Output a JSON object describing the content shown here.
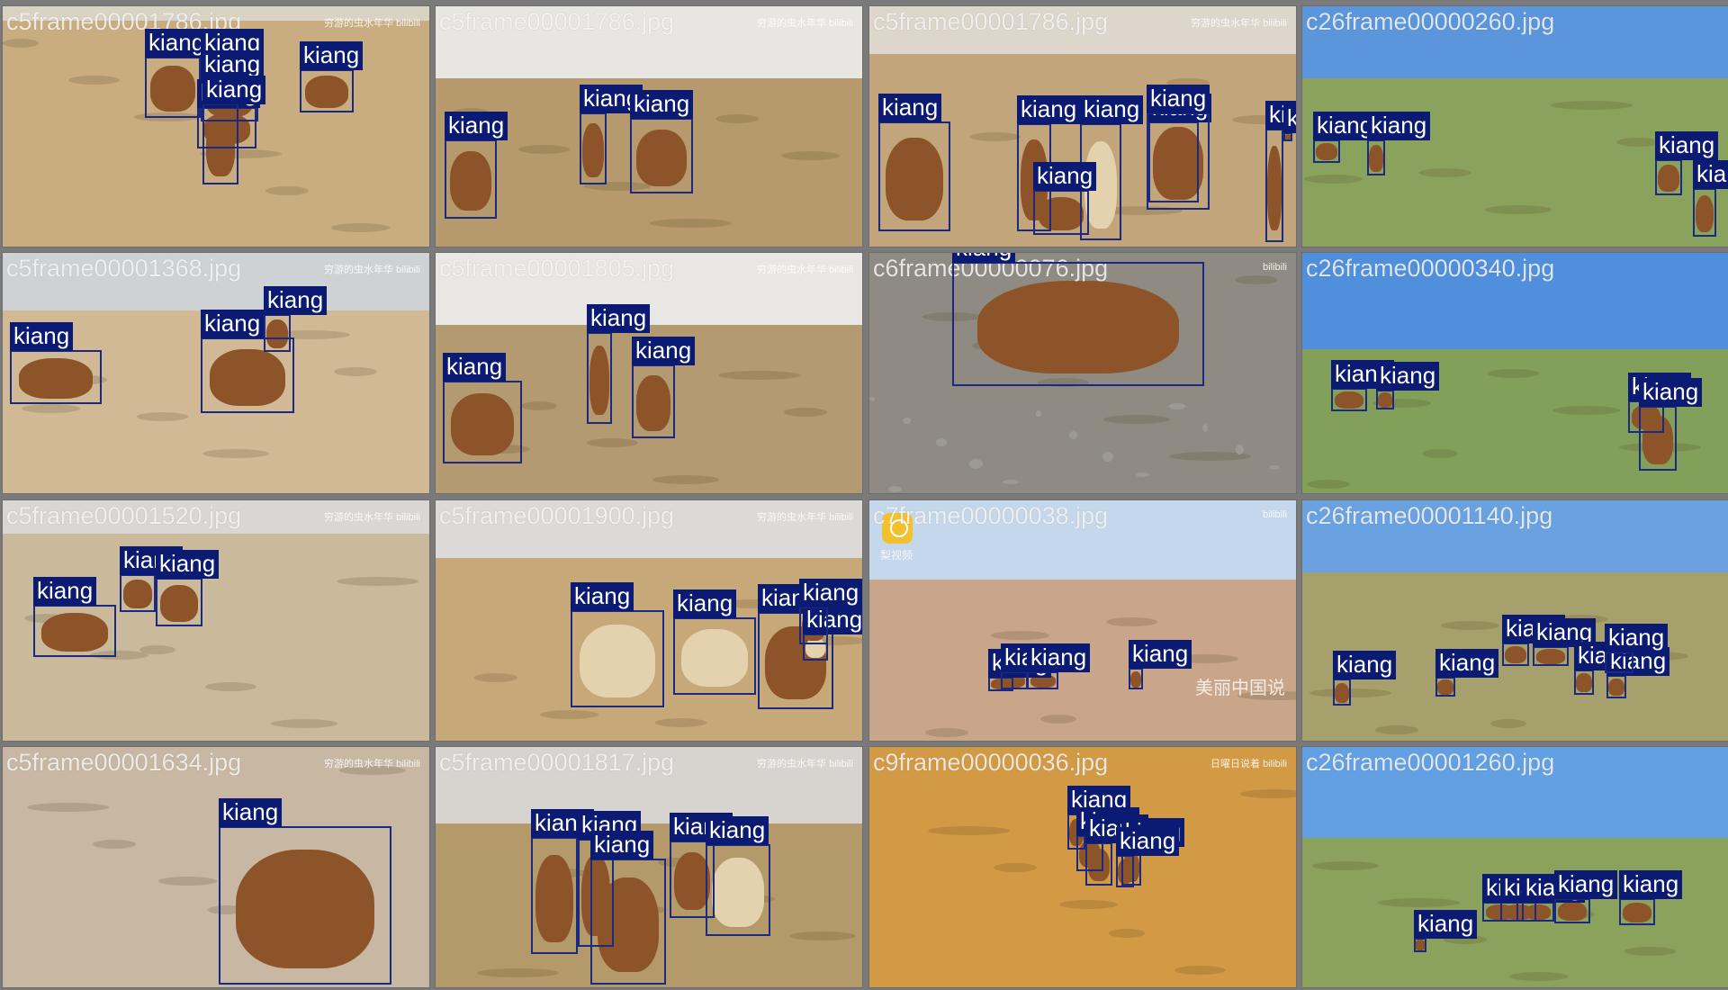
{
  "mosaic": {
    "tiles": [
      {
        "filename": "c5frame00001786.jpg",
        "watermark": "穷游的虫水年华 bilibili"
      },
      {
        "filename": "c5frame00001786.jpg",
        "watermark": "穷游的虫水年华 bilibili"
      },
      {
        "filename": "c5frame00001786.jpg",
        "watermark": "穷游的虫水年华 bilibili"
      },
      {
        "filename": "c26frame00000260.jpg",
        "watermark": ""
      },
      {
        "filename": "c5frame00001368.jpg",
        "watermark": "穷游的虫水年华 bilibili"
      },
      {
        "filename": "c5frame00001805.jpg",
        "watermark": "穷游的虫水年华 bilibili"
      },
      {
        "filename": "c6frame00000076.jpg",
        "watermark": "bilibili"
      },
      {
        "filename": "c26frame00000340.jpg",
        "watermark": ""
      },
      {
        "filename": "c5frame00001520.jpg",
        "watermark": "穷游的虫水年华 bilibili"
      },
      {
        "filename": "c5frame00001900.jpg",
        "watermark": "穷游的虫水年华 bilibili"
      },
      {
        "filename": "c7frame00000038.jpg",
        "watermark": "bilibili",
        "overlay": "美丽中国说",
        "logo_text": "梨视频"
      },
      {
        "filename": "c26frame00001140.jpg",
        "watermark": ""
      },
      {
        "filename": "c5frame00001634.jpg",
        "watermark": "穷游的虫水年华 bilibili"
      },
      {
        "filename": "c5frame00001817.jpg",
        "watermark": "穷游的虫水年华 bilibili"
      },
      {
        "filename": "c9frame00000036.jpg",
        "watermark": "日曜日说着 bilibili"
      },
      {
        "filename": "c26frame00001260.jpg",
        "watermark": ""
      }
    ],
    "detections": [
      [
        {
          "label": "kiang"
        },
        {
          "label": "kiang"
        },
        {
          "label": "kiang"
        },
        {
          "label": "kiang"
        },
        {
          "label": "kiang"
        }
      ],
      [
        {
          "label": "kiang"
        },
        {
          "label": "kiang"
        },
        {
          "label": "kiang"
        }
      ],
      [
        {
          "label": "kiang"
        },
        {
          "label": "kiang"
        },
        {
          "label": "kiang"
        },
        {
          "label": "kiang"
        },
        {
          "label": "kiang"
        },
        {
          "label": "kiang"
        },
        {
          "label": "kiang"
        },
        {
          "label": "kiang"
        }
      ],
      [
        {
          "label": "kiang"
        },
        {
          "label": "kiang"
        },
        {
          "label": "kiang"
        },
        {
          "label": "kiang"
        }
      ],
      [
        {
          "label": "kiang"
        },
        {
          "label": "kiang"
        },
        {
          "label": "kiang"
        }
      ],
      [
        {
          "label": "kiang"
        },
        {
          "label": "kiang"
        },
        {
          "label": "kiang"
        }
      ],
      [
        {
          "label": "kiang"
        }
      ],
      [
        {
          "label": "kiang"
        },
        {
          "label": "kiang"
        },
        {
          "label": "kiang"
        },
        {
          "label": "kiang"
        }
      ],
      [
        {
          "label": "kiang"
        },
        {
          "label": "kiang"
        },
        {
          "label": "kiang"
        }
      ],
      [
        {
          "label": "kiang"
        },
        {
          "label": "kiang"
        },
        {
          "label": "kiang"
        },
        {
          "label": "kiang"
        },
        {
          "label": "kiang"
        }
      ],
      [
        {
          "label": "kiang"
        },
        {
          "label": "kiang"
        },
        {
          "label": "kiang"
        },
        {
          "label": "kiang"
        }
      ],
      [
        {
          "label": "kiang"
        },
        {
          "label": "kiang"
        },
        {
          "label": "kiang"
        },
        {
          "label": "kiang"
        },
        {
          "label": "kiang"
        },
        {
          "label": "kiang"
        },
        {
          "label": "kiang"
        }
      ],
      [
        {
          "label": "kiang"
        }
      ],
      [
        {
          "label": "kiang"
        },
        {
          "label": "kiang"
        },
        {
          "label": "kiang"
        },
        {
          "label": "kiang"
        },
        {
          "label": "kiang"
        }
      ],
      [
        {
          "label": "kiang"
        },
        {
          "label": "kiang"
        },
        {
          "label": "kiang"
        },
        {
          "label": "kiang"
        }
      ],
      [
        {
          "label": "kiang"
        },
        {
          "label": "kiang"
        },
        {
          "label": "kiang"
        },
        {
          "label": "kiang"
        },
        {
          "label": "kiang"
        }
      ]
    ]
  },
  "colors": {
    "box_border": "#1a2a80",
    "label_bg": "#0b1a73",
    "label_text": "#ffffff",
    "tile_border": "#7a7a7a"
  }
}
